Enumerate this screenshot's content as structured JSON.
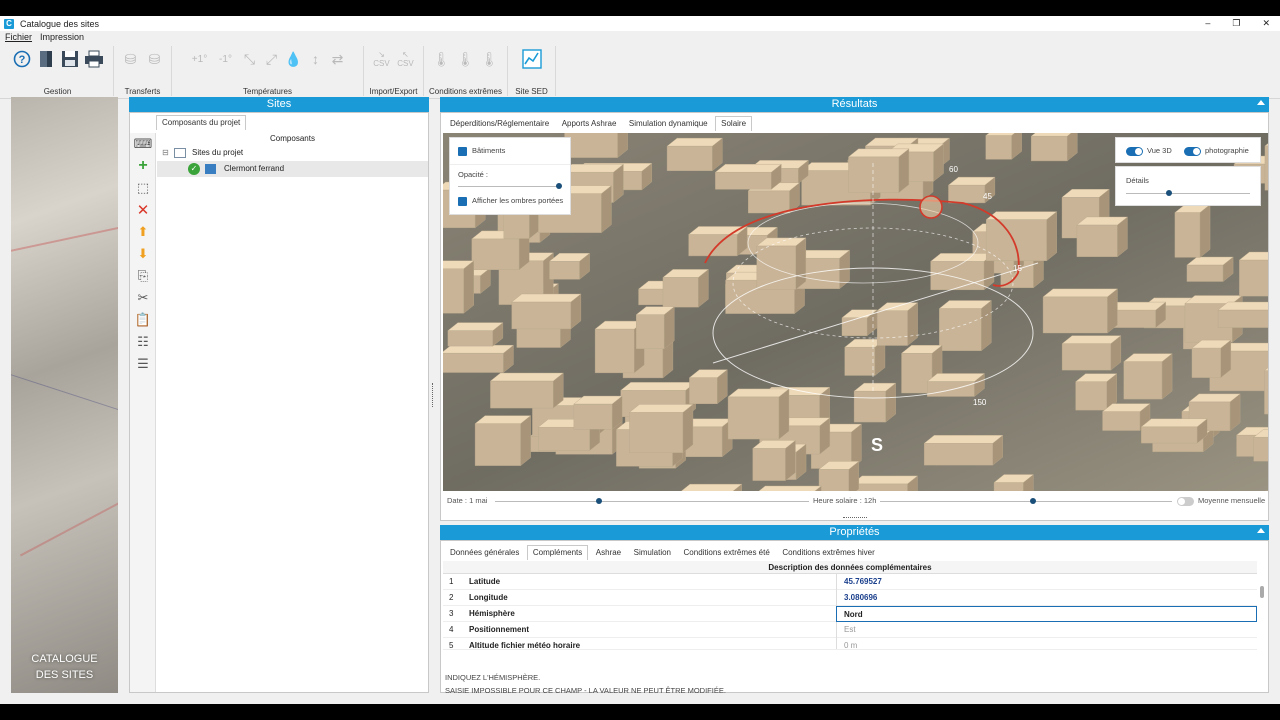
{
  "window": {
    "title": "Catalogue des sites",
    "app_icon": "C"
  },
  "menu": [
    "Fichier",
    "Impression"
  ],
  "ribbon": {
    "groups": [
      {
        "label": "Gestion"
      },
      {
        "label": "Transferts"
      },
      {
        "label": "Températures",
        "icon_texts": [
          "+1°",
          "-1°"
        ]
      },
      {
        "label": "Import/Export",
        "icon_texts": [
          "CSV",
          "CSV"
        ]
      },
      {
        "label": "Conditions extrêmes"
      },
      {
        "label": "Site SED"
      }
    ]
  },
  "side": {
    "title_line1": "CATALOGUE",
    "title_line2": "DES SITES"
  },
  "sites": {
    "header": "Sites",
    "tab": "Composants du projet",
    "tree_header": "Composants",
    "root": "Sites du projet",
    "child": "Clermont ferrand"
  },
  "results": {
    "header": "Résultats",
    "tabs": [
      "Déperditions/Réglementaire",
      "Apports Ashrae",
      "Simulation dynamique",
      "Solaire"
    ],
    "active_tab": "Solaire",
    "layers": {
      "buildings_label": "Bâtiments",
      "opacity_label": "Opacité :",
      "shadows_label": "Afficher les ombres portées"
    },
    "view": {
      "vue3d_label": "Vue 3D",
      "photo_label": "photographie",
      "details_label": "Détails"
    },
    "compass_label": "S",
    "sunpath_labels": [
      "60",
      "45",
      "15",
      "150"
    ],
    "time": {
      "date_label": "Date : 1 mai",
      "hour_label": "Heure solaire : 12h",
      "monthly_label": "Moyenne mensuelle"
    }
  },
  "props": {
    "header": "Propriétés",
    "tabs": [
      "Données générales",
      "Compléments",
      "Ashrae",
      "Simulation",
      "Conditions extrêmes été",
      "Conditions extrêmes hiver"
    ],
    "active_tab": "Compléments",
    "grid_header": "Description des données complémentaires",
    "rows": [
      {
        "num": "1",
        "label": "Latitude",
        "value": "45.769527"
      },
      {
        "num": "2",
        "label": "Longitude",
        "value": "3.080696"
      },
      {
        "num": "3",
        "label": "Hémisphère",
        "value": "Nord"
      },
      {
        "num": "4",
        "label": "Positionnement",
        "value": "Est"
      },
      {
        "num": "5",
        "label": "Altitude fichier météo horaire",
        "value": "0 m"
      }
    ],
    "help_line1": "INDIQUEZ L'HÉMISPHÈRE.",
    "help_line2": "SAISIE IMPOSSIBLE POUR CE CHAMP - LA VALEUR NE PEUT ÊTRE MODIFIÉE."
  },
  "colors": {
    "accent": "#1a9bd7",
    "building": "#eed9b8",
    "sun_path": "#d33a2a"
  }
}
